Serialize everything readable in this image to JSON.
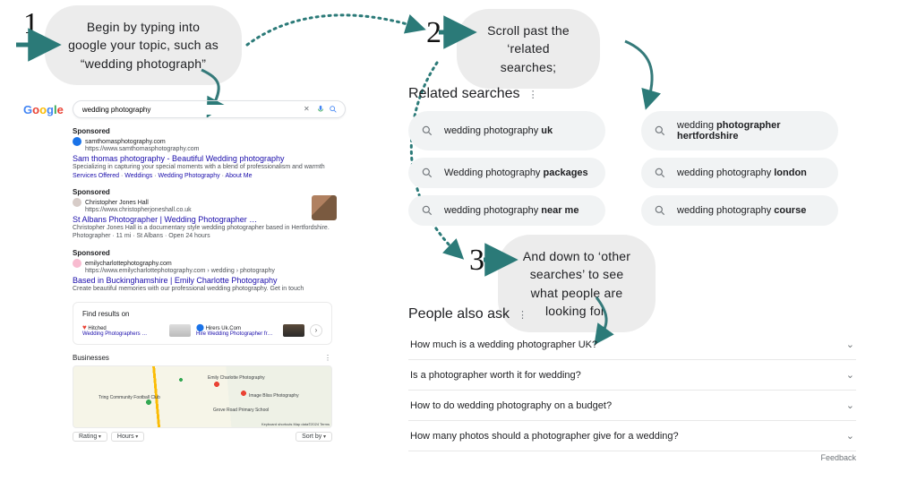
{
  "steps": {
    "s1": {
      "num": "1",
      "text": "Begin by typing into google your topic, such as “wedding photograph”"
    },
    "s2": {
      "num": "2",
      "text": "Scroll past the ‘related searches;"
    },
    "s3": {
      "num": "3",
      "text": "And down to ‘other searches’ to see what people are looking for."
    }
  },
  "search": {
    "query": "wedding photography"
  },
  "results": {
    "r1": {
      "sponsored": "Sponsored",
      "host": "samthomasphotography.com",
      "url": "https://www.samthomasphotography.com",
      "title": "Sam thomas photography - Beautiful Wedding photography",
      "desc": "Specializing in capturing your special moments with a blend of professionalism and warmth",
      "ql1": "Services Offered",
      "ql2": "Weddings",
      "ql3": "Wedding Photography",
      "ql4": "About Me"
    },
    "r2": {
      "sponsored": "Sponsored",
      "host": "Christopher Jones Hall",
      "url": "https://www.christopherjoneshall.co.uk",
      "title": "St Albans Photographer | Wedding Photographer …",
      "desc": "Christopher Jones Hall is a documentary style wedding photographer based in Hertfordshire.",
      "meta": "Photographer · 11 mi · St Albans · Open 24 hours"
    },
    "r3": {
      "sponsored": "Sponsored",
      "host": "emilycharlottephotography.com",
      "url": "https://www.emilycharlottephotography.com › wedding › photography",
      "title": "Based in Buckinghamshire | Emily Charlotte Photography",
      "desc": "Create beautiful memories with our professional wedding photography. Get in touch"
    }
  },
  "find": {
    "title": "Find results on",
    "i1_name": "Hitched",
    "i1_link": "Wedding Photographers …",
    "i2_name": "Hirers Uk.Com",
    "i2_link": "Hire Wedding Photographer fr…"
  },
  "biz": {
    "title": "Businesses",
    "label1": "Emily Charlotte Photography",
    "label2": "Tring Community Football Club",
    "label3": "Grove Road Primary School",
    "label4": "Image Bliss Photography",
    "rating": "Rating",
    "hours": "Hours",
    "sort": "Sort by",
    "attrib": "Keyboard shortcuts   Map data©2024   Terms"
  },
  "related": {
    "title": "Related searches",
    "items": {
      "a": {
        "pre": "wedding photography ",
        "bold": "uk"
      },
      "b": {
        "pre": "wedding ",
        "bold": "photographer hertfordshire"
      },
      "c": {
        "pre": "Wedding photography ",
        "bold": "packages"
      },
      "d": {
        "pre": "wedding photography ",
        "bold": "london"
      },
      "e": {
        "pre": "wedding photography ",
        "bold": "near me"
      },
      "f": {
        "pre": "wedding photography ",
        "bold": "course"
      }
    }
  },
  "paa": {
    "title": "People also ask",
    "q1": "How much is a wedding photographer UK?",
    "q2": "Is a photographer worth it for wedding?",
    "q3": "How to do wedding photography on a budget?",
    "q4": "How many photos should a photographer give for a wedding?",
    "feedback": "Feedback"
  }
}
